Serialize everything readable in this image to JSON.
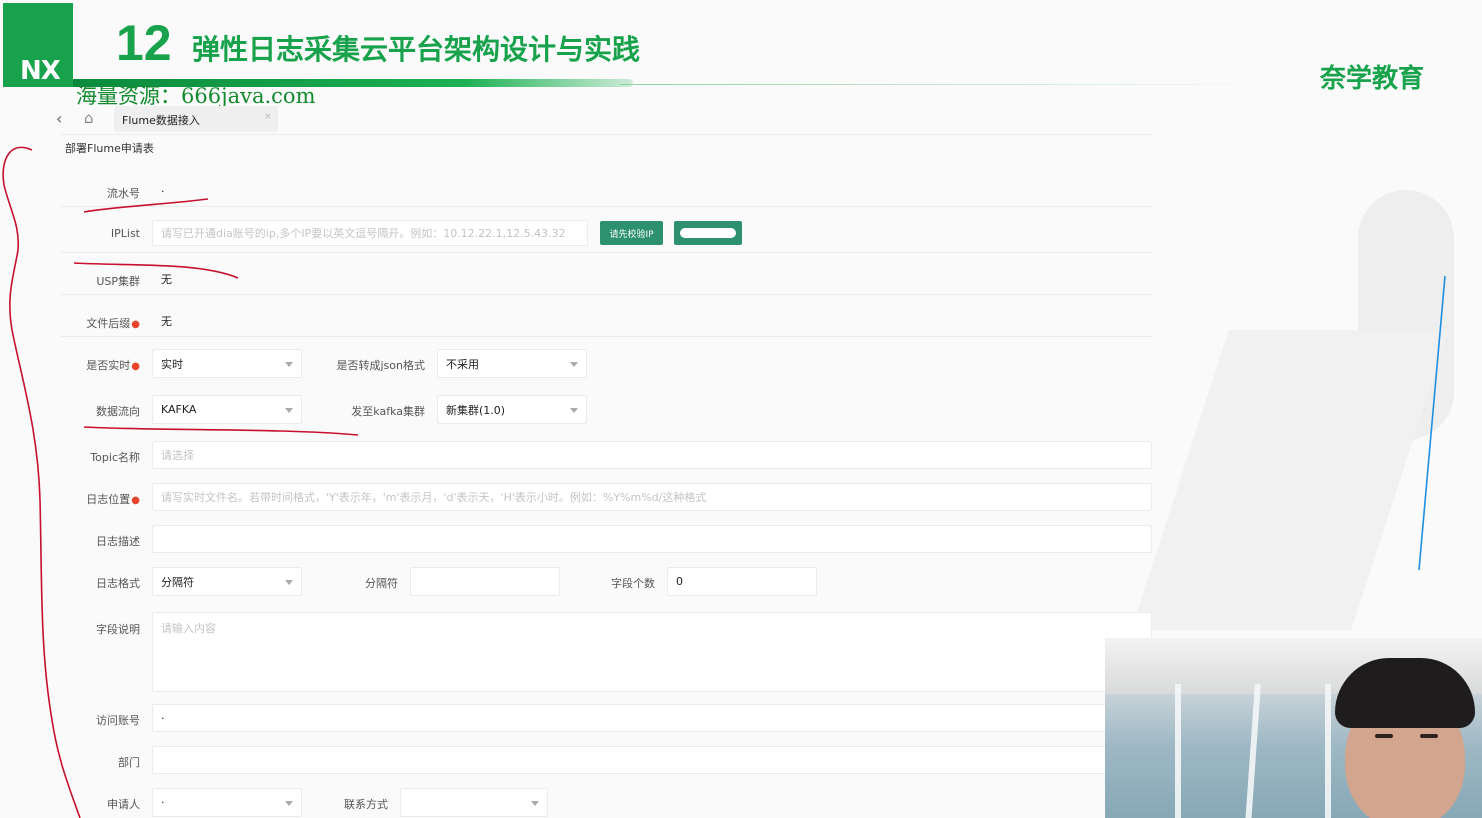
{
  "slide": {
    "logo_text": "NX",
    "lesson_number": "12",
    "lesson_title": "弹性日志采集云平台架构设计与实践",
    "brand": "奈学教育",
    "watermark": "海量资源：666java.com"
  },
  "tabs": [
    {
      "label": "Flume数据接入",
      "close": "×"
    }
  ],
  "form_title": "部署Flume申请表",
  "form": {
    "serial_no": {
      "label": "流水号",
      "value": "·"
    },
    "ip_list": {
      "label": "IPList",
      "placeholder": "请写已开通dia账号的ip,多个IP要以英文逗号隔开。例如：10.12.22.1,12.5.43.32",
      "verify_button": "请先校验IP"
    },
    "usp_cluster": {
      "label": "USP集群",
      "value": "无"
    },
    "file_suffix": {
      "label": "文件后缀",
      "value": "无",
      "required": true
    },
    "realtime": {
      "label": "是否实时",
      "value": "实时",
      "required": true
    },
    "to_json": {
      "label": "是否转成json格式",
      "value": "不采用"
    },
    "data_flow": {
      "label": "数据流向",
      "value": "KAFKA"
    },
    "kafka_cluster": {
      "label": "发至kafka集群",
      "value": "新集群(1.0)"
    },
    "topic": {
      "label": "Topic名称",
      "placeholder": "请选择"
    },
    "log_location": {
      "label": "日志位置",
      "required": true,
      "placeholder": "请写实时文件名。若带时间格式，'Y'表示年，'m'表示月，'d'表示天，'H'表示小时。例如：%Y%m%d/这种格式"
    },
    "log_desc": {
      "label": "日志描述",
      "value": ""
    },
    "log_format": {
      "label": "日志格式",
      "value": "分隔符"
    },
    "delimiter": {
      "label": "分隔符",
      "value": ""
    },
    "field_count": {
      "label": "字段个数",
      "value": "0"
    },
    "field_desc": {
      "label": "字段说明",
      "placeholder": "请输入内容"
    },
    "access_account": {
      "label": "访问账号",
      "value": "·"
    },
    "department": {
      "label": "部门",
      "value": ""
    },
    "applicant": {
      "label": "申请人",
      "value": "·"
    },
    "contact": {
      "label": "联系方式",
      "value": ""
    }
  },
  "icons": [
    "back-arrow-icon",
    "home-icon",
    "close-icon",
    "chevron-down-icon"
  ],
  "colors": {
    "brand_green": "#17a24b",
    "button_teal": "#2d9170",
    "required_dot": "#e6452a",
    "annotation_red": "#c8102e",
    "annotation_blue": "#1e8fe0"
  }
}
